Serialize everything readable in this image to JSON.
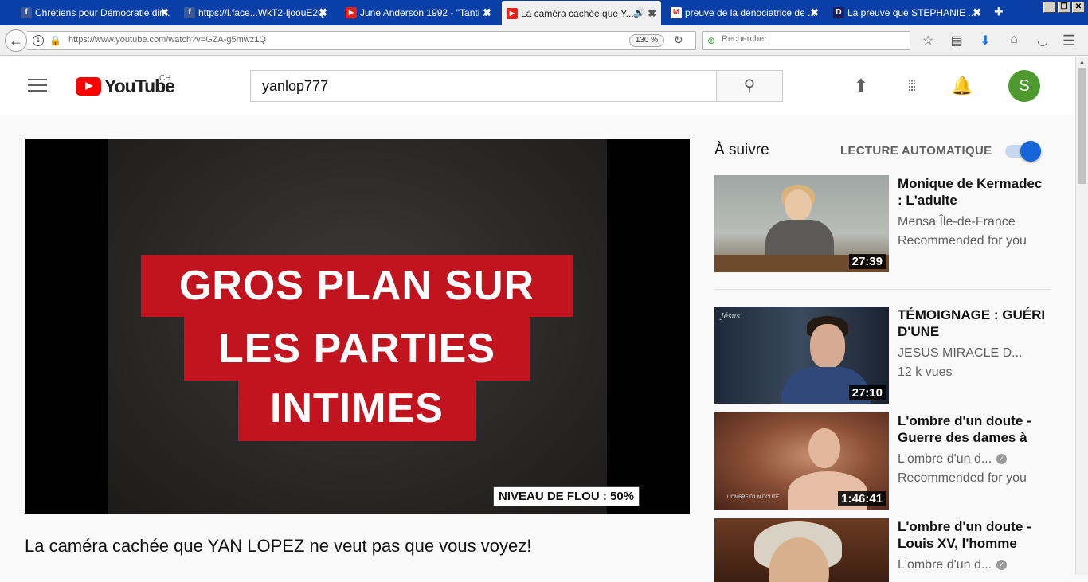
{
  "browser": {
    "tabs": [
      {
        "label": "Chrétiens pour Démocratie dir...",
        "favicon": "facebook-icon",
        "active": false
      },
      {
        "label": "https://l.face...WkT2-ljoouE2Q",
        "favicon": "facebook-icon",
        "active": false
      },
      {
        "label": "June Anderson 1992 - \"Tanti ...",
        "favicon": "youtube-icon",
        "active": false
      },
      {
        "label": "La caméra cachée que Y...",
        "favicon": "youtube-icon",
        "active": true
      },
      {
        "label": "preuve de la dénociatrice de ...",
        "favicon": "gmail-icon",
        "active": false
      },
      {
        "label": "La preuve que STEPHANIE ...",
        "favicon": "dp-icon",
        "active": false
      }
    ],
    "close_glyph": "✖",
    "new_tab_glyph": "+",
    "url": "https://www.youtube.com/watch?v=GZA-g5mwz1Q",
    "zoom": "130 %",
    "search_placeholder": "Rechercher"
  },
  "youtube": {
    "country": "CH",
    "logo_text": "YouTube",
    "search_value": "yanlop777",
    "avatar_letter": "S",
    "video": {
      "caption_lines": [
        "GROS PLAN SUR",
        "LES PARTIES",
        "INTIMES"
      ],
      "blur_label": "NIVEAU DE FLOU : 50%",
      "title": "La caméra cachée que YAN LOPEZ ne veut pas que vous voyez!"
    },
    "sidebar": {
      "up_next": "À suivre",
      "autoplay_label": "LECTURE AUTOMATIQUE",
      "autoplay_on": true,
      "items": [
        {
          "title": "Monique de Kermadec : L'adulte",
          "channel": "Mensa Île-de-France",
          "meta": "Recommended for you",
          "duration": "27:39",
          "verified": false
        },
        {
          "title": "TÉMOIGNAGE : GUÉRI D'UNE",
          "channel": "JESUS MIRACLE D...",
          "meta": "12 k vues",
          "duration": "27:10",
          "verified": false
        },
        {
          "title": "L'ombre d'un doute - Guerre des dames à",
          "channel": "L'ombre d'un d...",
          "meta": "Recommended for you",
          "duration": "1:46:41",
          "verified": true
        },
        {
          "title": "L'ombre d'un doute - Louis XV, l'homme",
          "channel": "L'ombre d'un d...",
          "meta": "",
          "duration": "",
          "verified": true
        }
      ]
    }
  },
  "colors": {
    "brand_red": "#ff0000",
    "caption_red": "#c1141f",
    "toggle_blue": "#1565d8",
    "avatar_green": "#4e9a2e",
    "tab_bar_blue": "#0a3fa8"
  }
}
